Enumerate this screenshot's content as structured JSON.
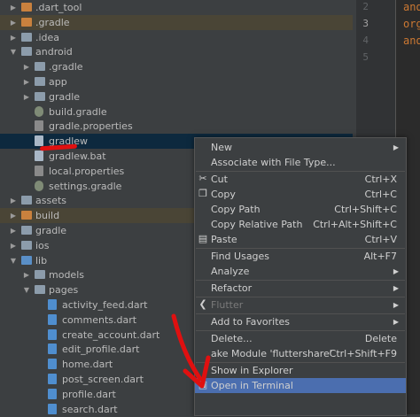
{
  "tree": [
    {
      "label": ".dart_tool",
      "depth": 0,
      "arrow": "right",
      "icon": "folder-orange"
    },
    {
      "label": ".gradle",
      "depth": 0,
      "arrow": "right",
      "icon": "folder-orange",
      "highlight": true
    },
    {
      "label": ".idea",
      "depth": 0,
      "arrow": "right",
      "icon": "folder"
    },
    {
      "label": "android",
      "depth": 0,
      "arrow": "down",
      "icon": "folder"
    },
    {
      "label": ".gradle",
      "depth": 1,
      "arrow": "right",
      "icon": "folder"
    },
    {
      "label": "app",
      "depth": 1,
      "arrow": "right",
      "icon": "folder"
    },
    {
      "label": "gradle",
      "depth": 1,
      "arrow": "right",
      "icon": "folder"
    },
    {
      "label": "build.gradle",
      "depth": 1,
      "arrow": "",
      "icon": "file-gradle"
    },
    {
      "label": "gradle.properties",
      "depth": 1,
      "arrow": "",
      "icon": "file-prop"
    },
    {
      "label": "gradlew",
      "depth": 1,
      "arrow": "",
      "icon": "file",
      "selected": true
    },
    {
      "label": "gradlew.bat",
      "depth": 1,
      "arrow": "",
      "icon": "file"
    },
    {
      "label": "local.properties",
      "depth": 1,
      "arrow": "",
      "icon": "file-prop"
    },
    {
      "label": "settings.gradle",
      "depth": 1,
      "arrow": "",
      "icon": "file-gradle"
    },
    {
      "label": "assets",
      "depth": 0,
      "arrow": "right",
      "icon": "folder"
    },
    {
      "label": "build",
      "depth": 0,
      "arrow": "right",
      "icon": "folder-orange",
      "highlight": true
    },
    {
      "label": "gradle",
      "depth": 0,
      "arrow": "right",
      "icon": "folder"
    },
    {
      "label": "ios",
      "depth": 0,
      "arrow": "right",
      "icon": "folder"
    },
    {
      "label": "lib",
      "depth": 0,
      "arrow": "down",
      "icon": "folder-blue"
    },
    {
      "label": "models",
      "depth": 1,
      "arrow": "right",
      "icon": "folder"
    },
    {
      "label": "pages",
      "depth": 1,
      "arrow": "down",
      "icon": "folder"
    },
    {
      "label": "activity_feed.dart",
      "depth": 2,
      "arrow": "",
      "icon": "file-dart"
    },
    {
      "label": "comments.dart",
      "depth": 2,
      "arrow": "",
      "icon": "file-dart"
    },
    {
      "label": "create_account.dart",
      "depth": 2,
      "arrow": "",
      "icon": "file-dart"
    },
    {
      "label": "edit_profile.dart",
      "depth": 2,
      "arrow": "",
      "icon": "file-dart"
    },
    {
      "label": "home.dart",
      "depth": 2,
      "arrow": "",
      "icon": "file-dart"
    },
    {
      "label": "post_screen.dart",
      "depth": 2,
      "arrow": "",
      "icon": "file-dart"
    },
    {
      "label": "profile.dart",
      "depth": 2,
      "arrow": "",
      "icon": "file-dart"
    },
    {
      "label": "search.dart",
      "depth": 2,
      "arrow": "",
      "icon": "file-dart"
    }
  ],
  "gutter": {
    "line_numbers": [
      "2",
      "3",
      "4",
      "5"
    ],
    "current_line": "3"
  },
  "editor": {
    "lines": [
      "and",
      "org",
      "and"
    ]
  },
  "context_menu": {
    "items": [
      {
        "label": "New",
        "shortcut": "",
        "submenu": true
      },
      {
        "label": "Associate with File Type...",
        "shortcut": "",
        "submenu": false
      },
      {
        "separator": true
      },
      {
        "label": "Cut",
        "shortcut": "Ctrl+X",
        "icon": "scissors-icon"
      },
      {
        "label": "Copy",
        "shortcut": "Ctrl+C",
        "icon": "copy-icon"
      },
      {
        "label": "Copy Path",
        "shortcut": "Ctrl+Shift+C"
      },
      {
        "label": "Copy Relative Path",
        "shortcut": "Ctrl+Alt+Shift+C"
      },
      {
        "label": "Paste",
        "shortcut": "Ctrl+V",
        "icon": "clipboard-icon"
      },
      {
        "separator": true
      },
      {
        "label": "Find Usages",
        "shortcut": "Alt+F7"
      },
      {
        "label": "Analyze",
        "shortcut": "",
        "submenu": true
      },
      {
        "separator": true
      },
      {
        "label": "Refactor",
        "shortcut": "",
        "submenu": true
      },
      {
        "separator": true
      },
      {
        "label": "Flutter",
        "shortcut": "",
        "submenu": true,
        "disabled": true,
        "icon": "flutter-icon"
      },
      {
        "separator": true
      },
      {
        "label": "Add to Favorites",
        "shortcut": "",
        "submenu": true
      },
      {
        "separator": true
      },
      {
        "label": "Delete...",
        "shortcut": "Delete"
      },
      {
        "label": "ake Module 'fluttershare'",
        "shortcut": "Ctrl+Shift+F9"
      },
      {
        "separator": true
      },
      {
        "label": "Show in Explorer",
        "shortcut": ""
      },
      {
        "label": "Open in Terminal",
        "shortcut": "",
        "active": true,
        "icon": "terminal-icon"
      }
    ]
  },
  "colors": {
    "selection": "#0d293e",
    "menu_active": "#4b6eaf",
    "annotation": "#e01010",
    "folder_excluded": "#c9813e"
  }
}
